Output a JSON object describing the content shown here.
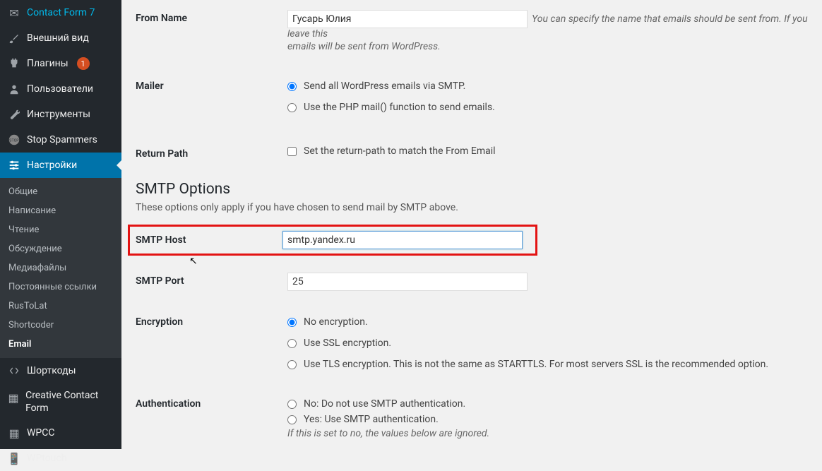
{
  "sidebar": {
    "items": [
      {
        "label": "Contact Form 7"
      },
      {
        "label": "Внешний вид"
      },
      {
        "label": "Плагины",
        "badge": "1"
      },
      {
        "label": "Пользователи"
      },
      {
        "label": "Инструменты"
      },
      {
        "label": "Stop Spammers"
      },
      {
        "label": "Настройки"
      },
      {
        "label": "Шорткоды"
      },
      {
        "label": "Creative Contact Form"
      },
      {
        "label": "WPCC"
      },
      {
        "label": "WPtouch"
      }
    ],
    "submenu": [
      {
        "label": "Общие"
      },
      {
        "label": "Написание"
      },
      {
        "label": "Чтение"
      },
      {
        "label": "Обсуждение"
      },
      {
        "label": "Медиафайлы"
      },
      {
        "label": "Постоянные ссылки"
      },
      {
        "label": "RusToLat"
      },
      {
        "label": "Shortcoder"
      },
      {
        "label": "Email"
      }
    ]
  },
  "form": {
    "from_name": {
      "label": "From Name",
      "value": "Гусарь Юлия",
      "desc_right": "You can specify the name that emails should be sent from. If you leave this",
      "desc_below": "emails will be sent from WordPress."
    },
    "mailer": {
      "label": "Mailer",
      "opt_smtp": "Send all WordPress emails via SMTP.",
      "opt_php": "Use the PHP mail() function to send emails."
    },
    "return_path": {
      "label": "Return Path",
      "check": "Set the return-path to match the From Email"
    },
    "smtp_heading": "SMTP Options",
    "smtp_desc": "These options only apply if you have chosen to send mail by SMTP above.",
    "smtp_host": {
      "label": "SMTP Host",
      "value": "smtp.yandex.ru"
    },
    "smtp_port": {
      "label": "SMTP Port",
      "value": "25"
    },
    "encryption": {
      "label": "Encryption",
      "opt_none": "No encryption.",
      "opt_ssl": "Use SSL encryption.",
      "opt_tls": "Use TLS encryption. This is not the same as STARTTLS. For most servers SSL is the recommended option."
    },
    "auth": {
      "label": "Authentication",
      "opt_no": "No: Do not use SMTP authentication.",
      "opt_yes": "Yes: Use SMTP authentication.",
      "note": "If this is set to no, the values below are ignored."
    }
  }
}
